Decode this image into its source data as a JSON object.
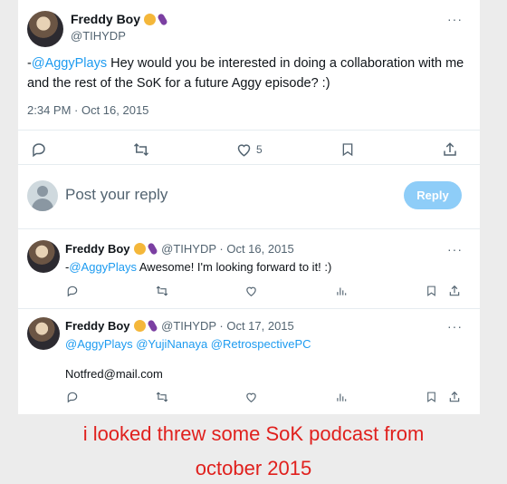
{
  "main_tweet": {
    "name": "Freddy Boy",
    "handle": "@TIHYDP",
    "more_label": "···",
    "text_prefix": "-",
    "mention": "@AggyPlays",
    "text": " Hey would you be interested in doing a collaboration with me and the rest of the SoK for a future Aggy episode? :)",
    "timestamp": "2:34 PM · Oct 16, 2015",
    "like_count": "5"
  },
  "reply_box": {
    "placeholder": "Post your reply",
    "button_label": "Reply"
  },
  "replies": [
    {
      "name": "Freddy Boy",
      "handle_date": "@TIHYDP · Oct 16, 2015",
      "more_label": "···",
      "text_prefix": "-",
      "mention": "@AggyPlays",
      "text": " Awesome! I'm looking forward to it! :)"
    },
    {
      "name": "Freddy Boy",
      "handle_date": "@TIHYDP · Oct 17, 2015",
      "more_label": "···",
      "mentions": "@AggyPlays @YujiNanaya @RetrospectivePC",
      "text": "Notfred@mail.com"
    }
  ],
  "caption": {
    "line1": "i looked threw some SoK podcast from",
    "line2": "october 2015"
  },
  "colors": {
    "link": "#1d9bf0",
    "caption": "#e0201d",
    "reply_button": "#8ecdf8"
  },
  "icons": [
    "reply-icon",
    "retweet-icon",
    "like-icon",
    "bookmark-icon",
    "share-icon",
    "views-icon",
    "more-icon"
  ]
}
